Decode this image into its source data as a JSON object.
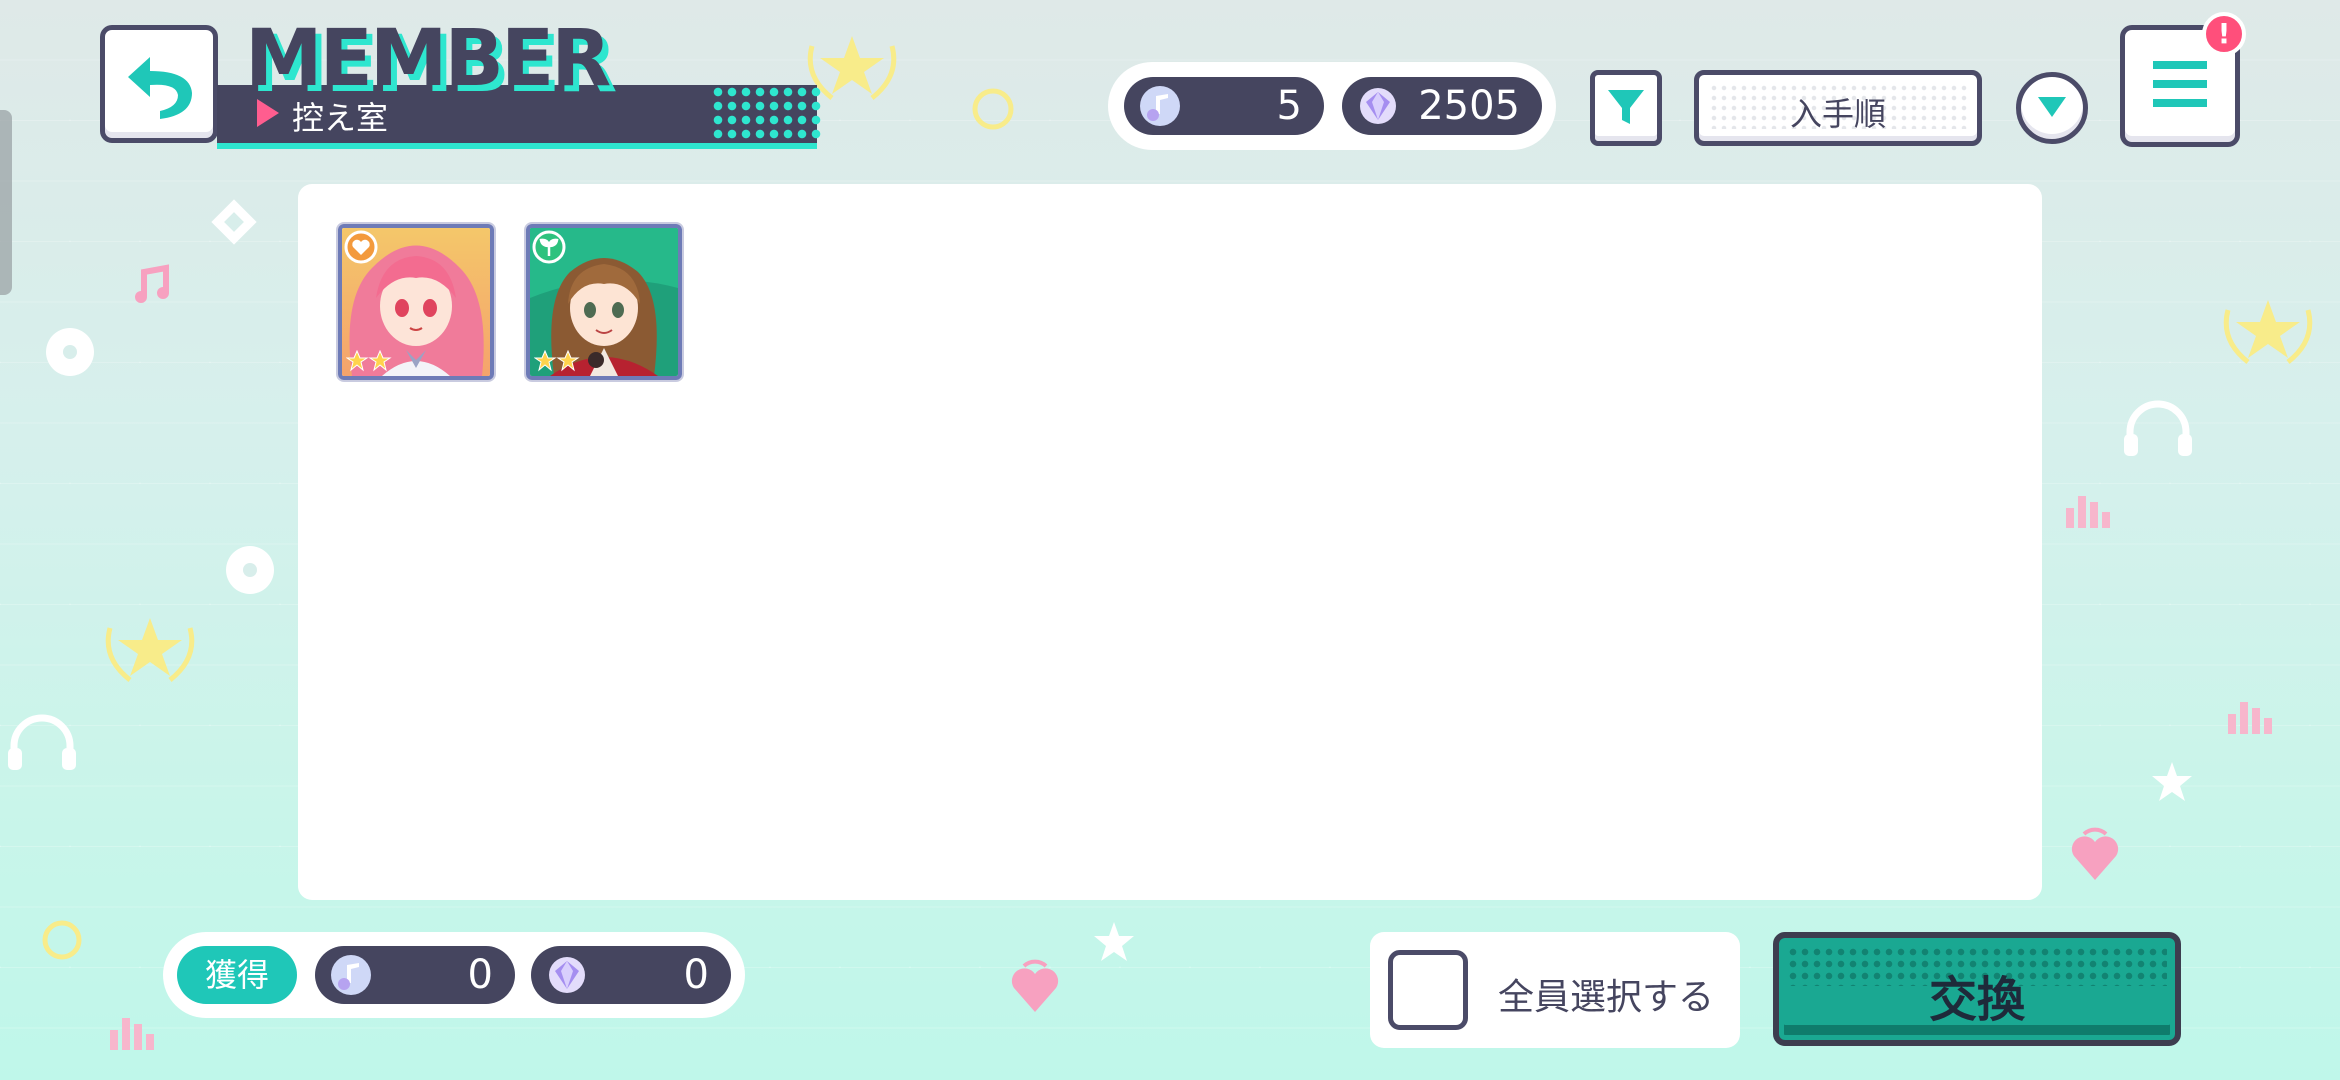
{
  "header": {
    "title": "MEMBER",
    "subtitle": "控え室"
  },
  "currency": {
    "notes": "5",
    "gems": "2505"
  },
  "toolbar": {
    "sort_label": "入手順"
  },
  "menu": {
    "badge": "!"
  },
  "members": [
    {
      "icon": "heart-attribute-icon",
      "stars": 2,
      "accent": "#f39a3d"
    },
    {
      "icon": "leaf-attribute-icon",
      "stars": 2,
      "accent": "#2ec27e"
    }
  ],
  "footer": {
    "earn_label": "獲得",
    "earn_notes": "0",
    "earn_gems": "0",
    "select_all_label": "全員選択する",
    "exchange_label": "交換"
  },
  "colors": {
    "navy": "#45455f",
    "teal": "#2ee6cf",
    "pink": "#ff5d8f",
    "exchange": "#1aa892"
  }
}
